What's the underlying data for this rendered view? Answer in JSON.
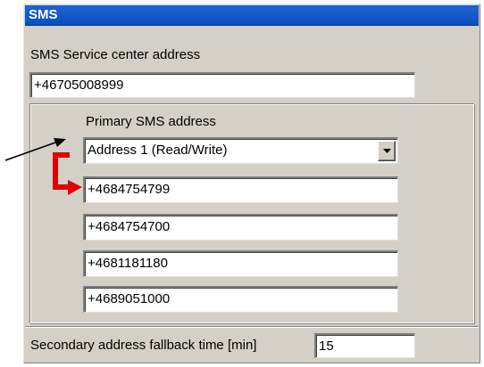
{
  "panel": {
    "title": "SMS"
  },
  "service_center": {
    "label": "SMS Service center address",
    "value": "+46705008999"
  },
  "primary": {
    "label": "Primary SMS address",
    "selected": "Address 1 (Read/Write)",
    "addresses": [
      "+4684754799",
      "+4684754700",
      "+4681181180",
      "+4689051000"
    ]
  },
  "fallback": {
    "label": "Secondary address fallback time [min]",
    "value": "15"
  },
  "colors": {
    "title_bar": "#0a50c8",
    "highlight_arrow": "#e00000",
    "pointer_arrow": "#000000"
  },
  "icons": [
    "chevron-down-icon",
    "callout-arrow-icon",
    "red-bent-arrow-icon"
  ]
}
